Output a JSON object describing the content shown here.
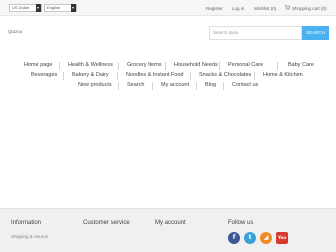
{
  "topbar": {
    "currency": "US Dollar",
    "language": "English",
    "links": {
      "register": "Register",
      "login": "Log in",
      "wishlist": "Wishlist (0)",
      "cart": "Shopping cart (0)"
    }
  },
  "header": {
    "logo": "Quizoo",
    "search_placeholder": "Search store",
    "search_button": "SEARCH"
  },
  "nav": {
    "items": [
      "Home page",
      "Health & Wellness",
      "Grocery Items",
      "Household Needs",
      "Personal Care",
      "Baby Care",
      "Beverages",
      "Bakery & Dairy",
      "Noodles & Instant Food",
      "Snacks & Chocolates",
      "Home & Kitchen",
      "New products",
      "Search",
      "My account",
      "Blog",
      "Contact us"
    ]
  },
  "footer": {
    "information": "Information",
    "customer_service": "Customer service",
    "my_account": "My account",
    "follow_us": "Follow us",
    "information_links": [
      "Shipping & returns"
    ],
    "social": [
      {
        "icon": "facebook-icon",
        "glyph": "f",
        "color": "#3b5998"
      },
      {
        "icon": "twitter-icon",
        "glyph": "t",
        "color": "#3aa1d8"
      },
      {
        "icon": "rss-icon",
        "glyph": "◢",
        "color": "#f08a25"
      },
      {
        "icon": "youtube-icon",
        "glyph": "You",
        "color": "#d83a2f"
      }
    ]
  }
}
